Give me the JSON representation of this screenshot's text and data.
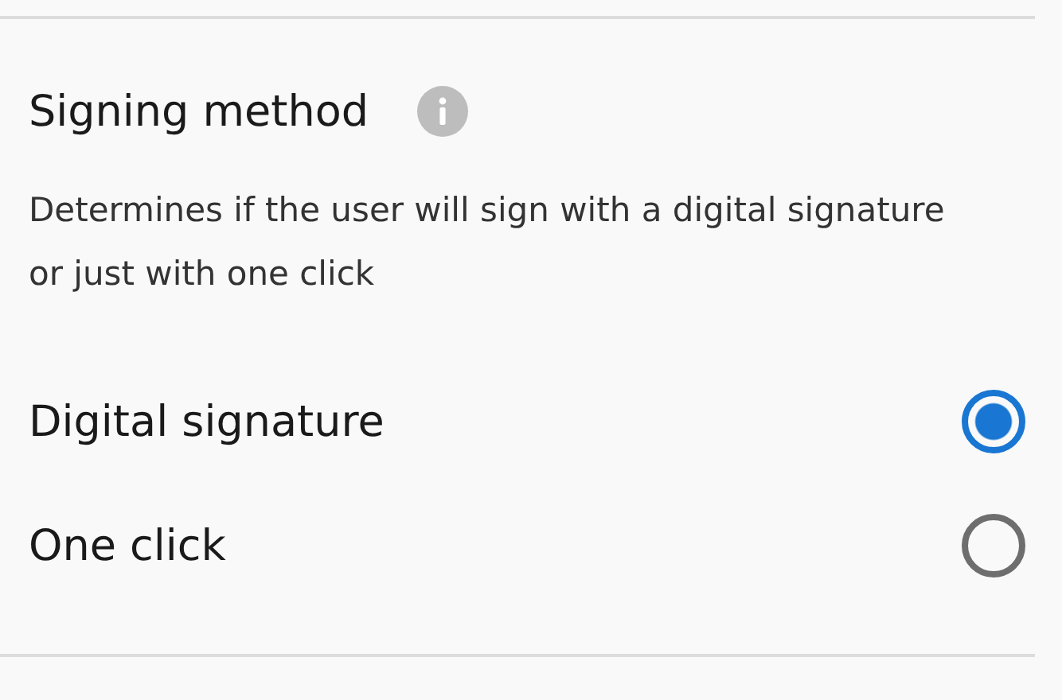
{
  "section": {
    "title": "Signing method",
    "description": "Determines if the user will sign with a digital signature or just with one click",
    "options": [
      {
        "label": "Digital signature",
        "selected": true
      },
      {
        "label": "One click",
        "selected": false
      }
    ]
  }
}
